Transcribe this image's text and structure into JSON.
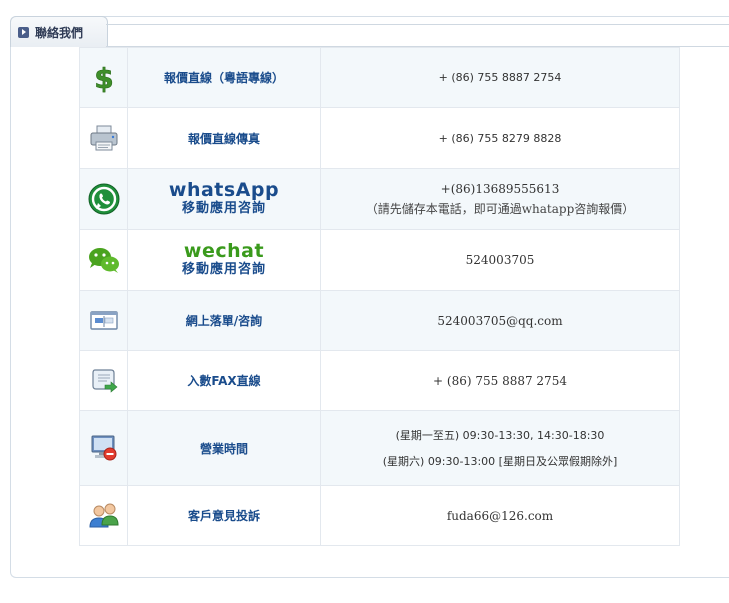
{
  "panel": {
    "title": "聯絡我們"
  },
  "rows": [
    {
      "icon": "dollar-icon",
      "label": "報價直線（粵語專線）",
      "value": "+ (86) 755 8887 2754"
    },
    {
      "icon": "fax-machine-icon",
      "label": "報價直線傳真",
      "value": "+ (86) 755 8279 8828"
    },
    {
      "icon": "whatsapp-icon",
      "label_big": "whatsApp",
      "label_sub": "移動應用咨詢",
      "value": "+(86)13689555613",
      "note": "（請先儲存本電話，即可通過whatapp咨詢報價）"
    },
    {
      "icon": "wechat-icon",
      "label_big": "wechat",
      "label_sub": "移動應用咨詢",
      "value": "524003705"
    },
    {
      "icon": "online-form-icon",
      "label": "網上落單/咨詢",
      "value": "524003705@qq.com"
    },
    {
      "icon": "fax-document-icon",
      "label": "入數FAX直線",
      "value": "+ (86) 755 8887 2754"
    },
    {
      "icon": "business-hours-icon",
      "label": "營業時間",
      "value": "(星期一至五) 09:30-13:30, 14:30-18:30",
      "value2": "(星期六) 09:30-13:00 [星期日及公眾假期除外]"
    },
    {
      "icon": "customer-feedback-icon",
      "label": "客戶意見投訴",
      "value": "fuda66@126.com"
    }
  ]
}
